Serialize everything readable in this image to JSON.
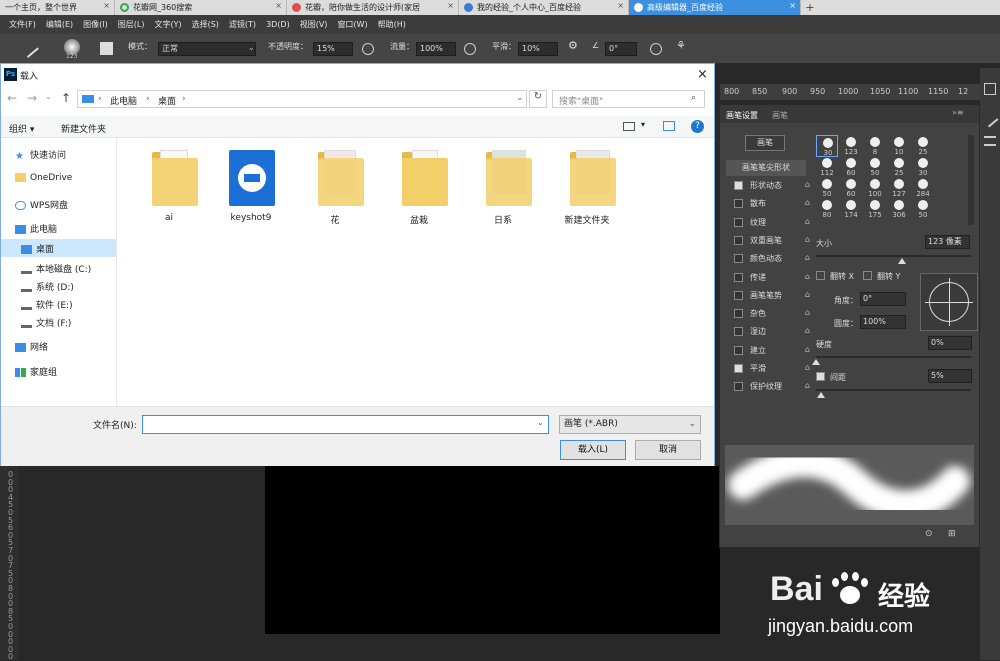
{
  "browser": {
    "tabs": [
      {
        "label": "一个主页，整个世界",
        "fav": ""
      },
      {
        "label": "花瓣网_360搜索",
        "fav": "#34a853"
      },
      {
        "label": "花瓣，陪你做生活的设计师(家居",
        "fav": "#e05050"
      },
      {
        "label": "我的经验_个人中心_百度经验",
        "fav": "#3a7bd5"
      },
      {
        "label": "高级编辑器_百度经验",
        "fav": "#ffffff"
      }
    ],
    "close": "×",
    "newtab": "+"
  },
  "menu": [
    "文件(F)",
    "编辑(E)",
    "图像(I)",
    "图层(L)",
    "文字(Y)",
    "选择(S)",
    "滤镜(T)",
    "3D(D)",
    "视图(V)",
    "窗口(W)",
    "帮助(H)"
  ],
  "options": {
    "brush_size": "123",
    "mode_label": "模式：",
    "mode_value": "正常",
    "opacity_label": "不透明度：",
    "opacity_value": "15%",
    "flow_label": "流量：",
    "flow_value": "100%",
    "smooth_label": "平滑：",
    "smooth_value": "10%",
    "angle_value": "0°"
  },
  "ruler": {
    "ticks": [
      "800",
      "850",
      "900",
      "950",
      "1000",
      "1050",
      "1100",
      "1150",
      "12"
    ]
  },
  "vruler": [
    "0",
    "0",
    "0",
    "4",
    "5",
    "0",
    "5",
    "6",
    "0",
    "5",
    "7",
    "0",
    "7",
    "5",
    "0",
    "8",
    "0",
    "0",
    "8",
    "5",
    "0",
    "0",
    "0",
    "0",
    "0"
  ],
  "dialog": {
    "title": "载入",
    "ps_icon": "Ps",
    "close": "×",
    "breadcrumb": [
      "此电脑",
      "桌面"
    ],
    "search_placeholder": "搜索\"桌面\"",
    "organize": "组织 ▾",
    "new_folder": "新建文件夹",
    "nav": [
      "快速访问",
      "OneDrive",
      "WPS网盘",
      "此电脑",
      "桌面",
      "本地磁盘 (C:)",
      "系统 (D:)",
      "软件 (E:)",
      "文档 (F:)",
      "网络",
      "家庭组"
    ],
    "files": [
      "ai",
      "keyshot9",
      "花",
      "盆栽",
      "日系",
      "新建文件夹"
    ],
    "filename_label": "文件名(N):",
    "filename_value": "",
    "filetype": "画笔 (*.ABR)",
    "load_button": "载入(L)",
    "cancel_button": "取消"
  },
  "panel": {
    "tabs": [
      "画笔设置",
      "画笔"
    ],
    "brush_button": "画笔",
    "tip_shape": "画笔笔尖形状",
    "list": [
      {
        "label": "形状动态",
        "on": true
      },
      {
        "label": "散布",
        "on": false
      },
      {
        "label": "纹理",
        "on": false
      },
      {
        "label": "双重画笔",
        "on": false
      },
      {
        "label": "颜色动态",
        "on": false
      },
      {
        "label": "传递",
        "on": false
      },
      {
        "label": "画笔笔势",
        "on": false
      },
      {
        "label": "杂色",
        "on": false
      },
      {
        "label": "湿边",
        "on": false
      },
      {
        "label": "建立",
        "on": false
      },
      {
        "label": "平滑",
        "on": true
      },
      {
        "label": "保护纹理",
        "on": false
      }
    ],
    "tip_sizes": [
      "30",
      "123",
      "8",
      "10",
      "25",
      "112",
      "60",
      "50",
      "25",
      "30",
      "50",
      "60",
      "100",
      "127",
      "284",
      "80",
      "174",
      "175",
      "306",
      "50"
    ],
    "size_label": "大小",
    "size_value": "123 像素",
    "flip_x": "翻转 X",
    "flip_y": "翻转 Y",
    "angle_label": "角度：",
    "angle_value": "0°",
    "roundness_label": "圆度：",
    "roundness_value": "100%",
    "hardness_label": "硬度",
    "hardness_value": "0%",
    "spacing_label": "间距",
    "spacing_value": "5%",
    "hardness_fraction": 0,
    "spacing_fraction": 0.03
  },
  "watermark": {
    "brand": "Bai",
    "brand2": "经验",
    "url": "jingyan.baidu.com"
  }
}
